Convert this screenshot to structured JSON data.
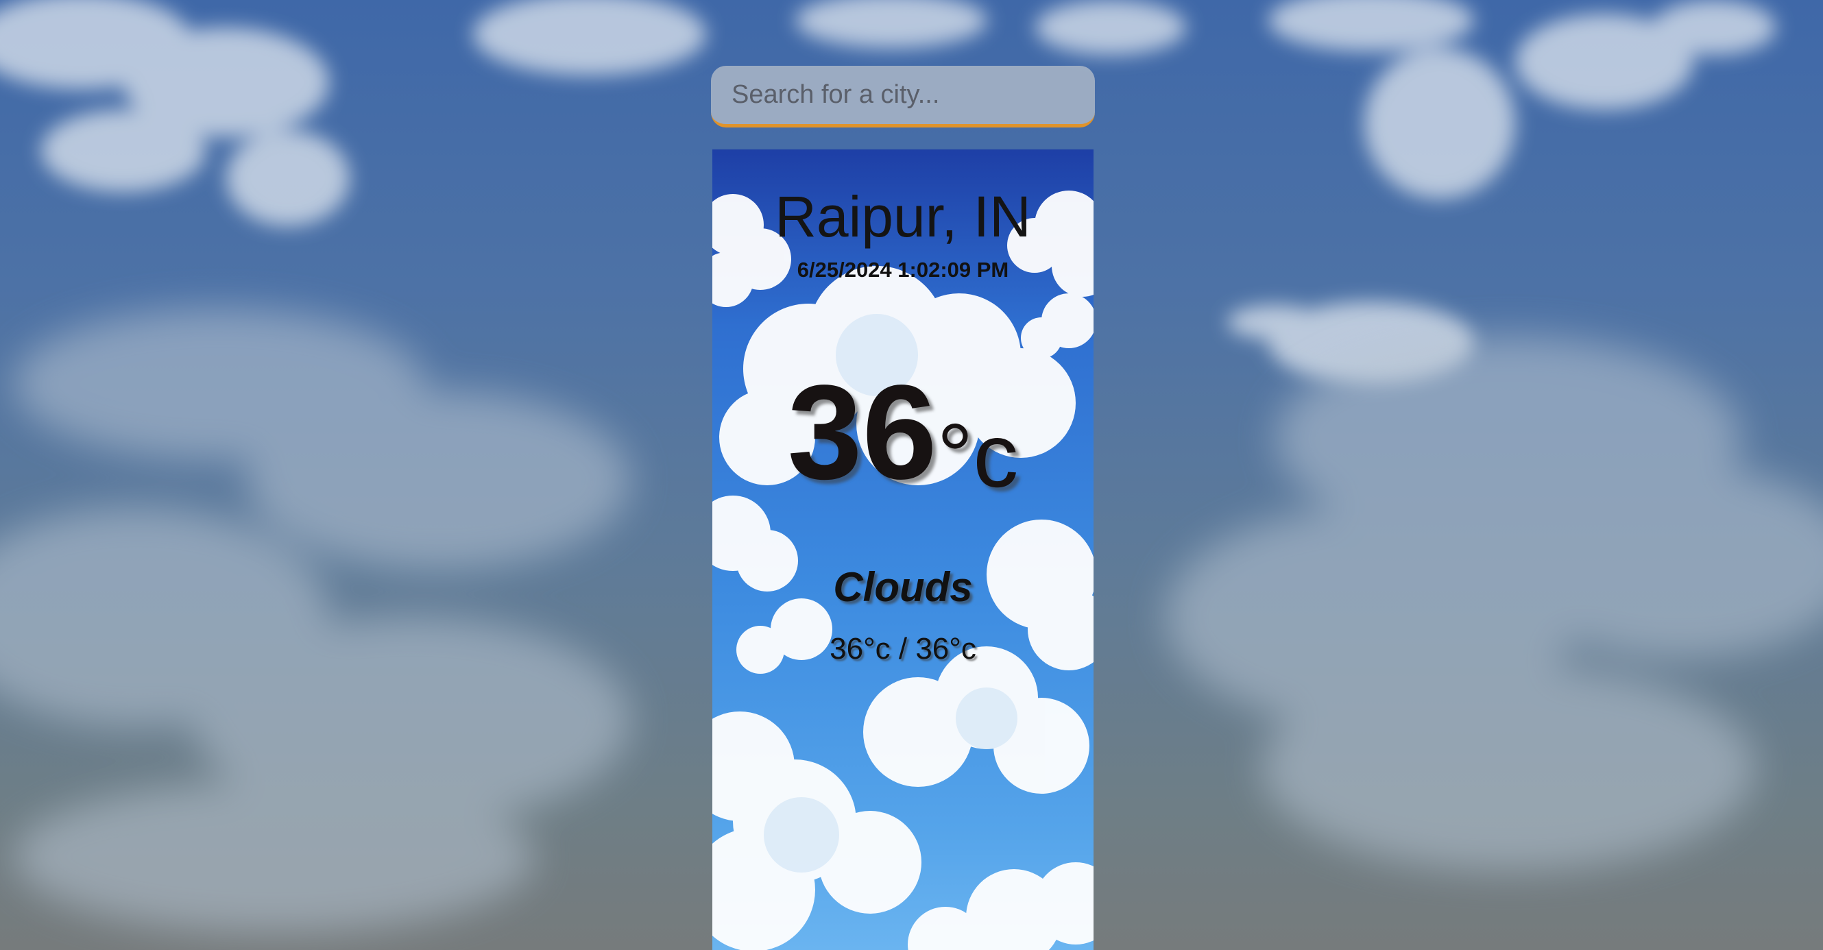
{
  "search": {
    "placeholder": "Search for a city...",
    "value": ""
  },
  "weather": {
    "city": "Raipur, IN",
    "datetime": "6/25/2024 1:02:09 PM",
    "temperature": "36",
    "temperature_unit": "°c",
    "condition": "Clouds",
    "high_low": "36°c / 36°c"
  },
  "colors": {
    "accent": "#e0932a",
    "text": "#141414",
    "card_top": "#1e3fa6",
    "card_bottom": "#6ab4f0"
  },
  "icons": {
    "background": "cloudy-sky-background",
    "card_background": "cartoon-clouds-background"
  }
}
